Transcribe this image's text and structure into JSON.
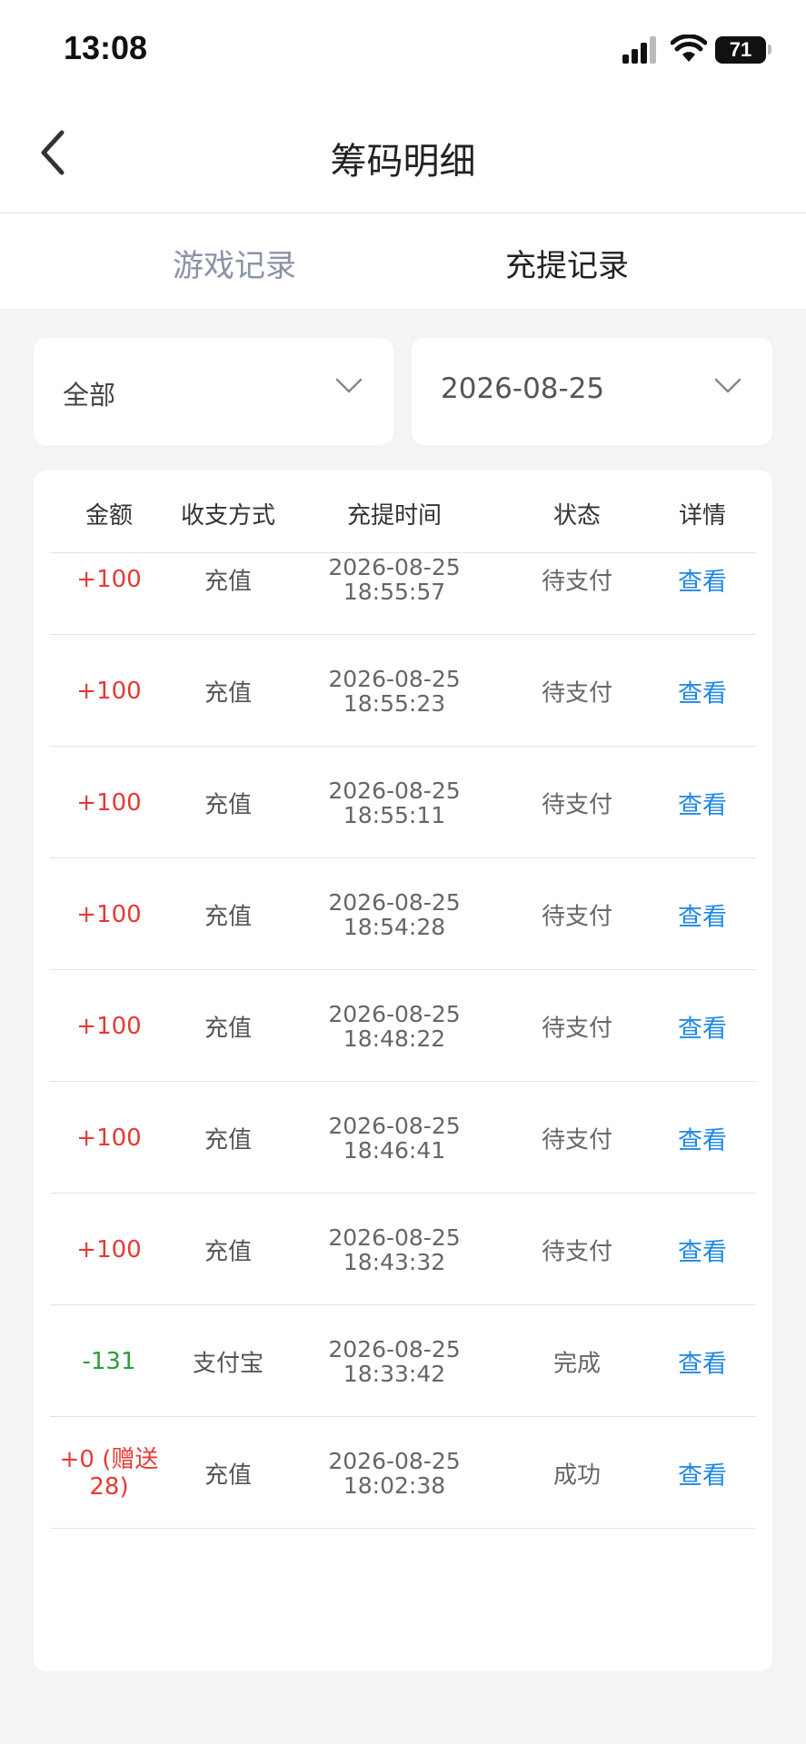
{
  "status_bar": {
    "time": "13:08",
    "battery": "71"
  },
  "header": {
    "title": "筹码明细"
  },
  "tabs": [
    {
      "label": "游戏记录",
      "active": false
    },
    {
      "label": "充提记录",
      "active": true
    }
  ],
  "filters": {
    "type": "全部",
    "date": "2026-08-25"
  },
  "table": {
    "columns": [
      "金额",
      "收支方式",
      "充提时间",
      "状态",
      "详情"
    ],
    "rows": [
      {
        "amount": "+100",
        "method": "充值",
        "date": "2026-08-25",
        "time": "18:55:57",
        "status": "待支付",
        "action": "查看"
      },
      {
        "amount": "+100",
        "method": "充值",
        "date": "2026-08-25",
        "time": "18:55:23",
        "status": "待支付",
        "action": "查看"
      },
      {
        "amount": "+100",
        "method": "充值",
        "date": "2026-08-25",
        "time": "18:55:11",
        "status": "待支付",
        "action": "查看"
      },
      {
        "amount": "+100",
        "method": "充值",
        "date": "2026-08-25",
        "time": "18:54:28",
        "status": "待支付",
        "action": "查看"
      },
      {
        "amount": "+100",
        "method": "充值",
        "date": "2026-08-25",
        "time": "18:48:22",
        "status": "待支付",
        "action": "查看"
      },
      {
        "amount": "+100",
        "method": "充值",
        "date": "2026-08-25",
        "time": "18:46:41",
        "status": "待支付",
        "action": "查看"
      },
      {
        "amount": "+100",
        "method": "充值",
        "date": "2026-08-25",
        "time": "18:43:32",
        "status": "待支付",
        "action": "查看"
      },
      {
        "amount": "-131",
        "method": "支付宝",
        "date": "2026-08-25",
        "time": "18:33:42",
        "status": "完成",
        "action": "查看"
      },
      {
        "amount": "+0 (赠送28)",
        "method": "充值",
        "date": "2026-08-25",
        "time": "18:02:38",
        "status": "成功",
        "action": "查看"
      }
    ]
  },
  "colors": {
    "positive": "#e53935",
    "negative": "#2e9e3a",
    "link": "#1e88e5",
    "inactive_tab": "#8a94a6"
  },
  "icons": {
    "back": "chevron-left-icon",
    "dropdown": "chevron-down-icon",
    "signal": "cellular-signal-icon",
    "wifi": "wifi-icon",
    "battery": "battery-icon"
  }
}
